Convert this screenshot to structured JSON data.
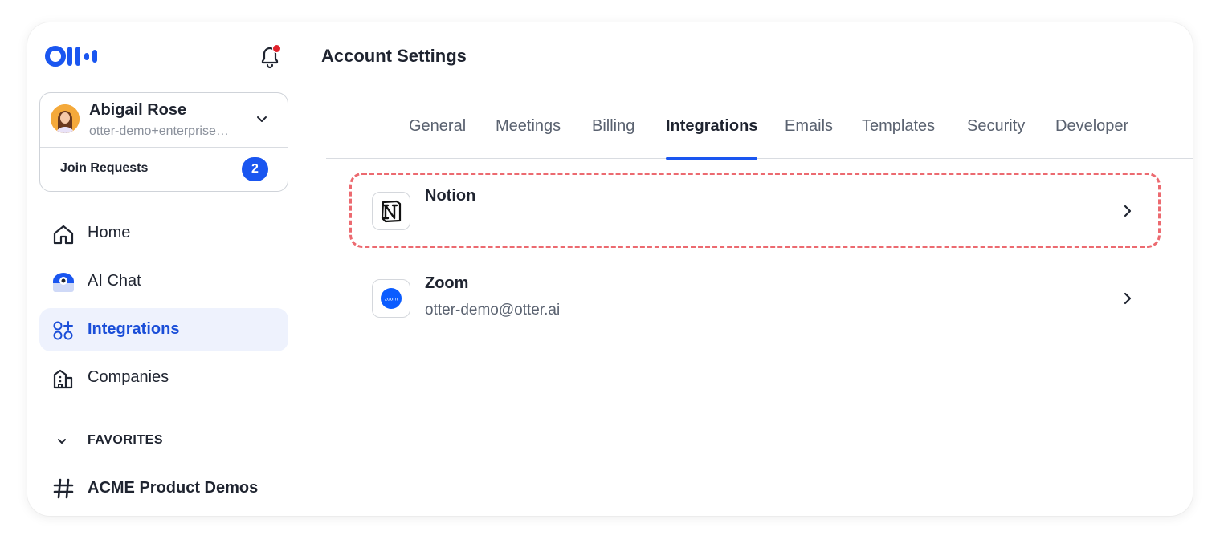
{
  "sidebar": {
    "account": {
      "name": "Abigail Rose",
      "email": "otter-demo+enterprise@otter.ai"
    },
    "join_requests": {
      "label": "Join Requests",
      "count": "2"
    },
    "nav": [
      {
        "label": "Home",
        "icon": "home-icon"
      },
      {
        "label": "AI Chat",
        "icon": "ai-chat-icon"
      },
      {
        "label": "Integrations",
        "icon": "integrations-icon",
        "active": true
      },
      {
        "label": "Companies",
        "icon": "companies-icon"
      }
    ],
    "favorites": {
      "label": "FAVORITES",
      "channels": [
        {
          "label": "ACME Product Demos",
          "icon": "hash-icon"
        }
      ]
    }
  },
  "main": {
    "title": "Account Settings",
    "tabs": [
      {
        "label": "General"
      },
      {
        "label": "Meetings"
      },
      {
        "label": "Billing"
      },
      {
        "label": "Integrations",
        "active": true
      },
      {
        "label": "Emails"
      },
      {
        "label": "Templates"
      },
      {
        "label": "Security"
      },
      {
        "label": "Developer"
      }
    ],
    "integrations": [
      {
        "name": "Notion",
        "subtitle": "",
        "icon": "notion-icon",
        "highlighted": true
      },
      {
        "name": "Zoom",
        "subtitle": "otter-demo@otter.ai",
        "icon": "zoom-icon",
        "highlighted": false
      }
    ]
  },
  "colors": {
    "accent": "#1a56f0",
    "active_nav_bg": "#eef2fd",
    "notification_dot": "#e0212b",
    "highlight_border": "#ec6a70"
  }
}
